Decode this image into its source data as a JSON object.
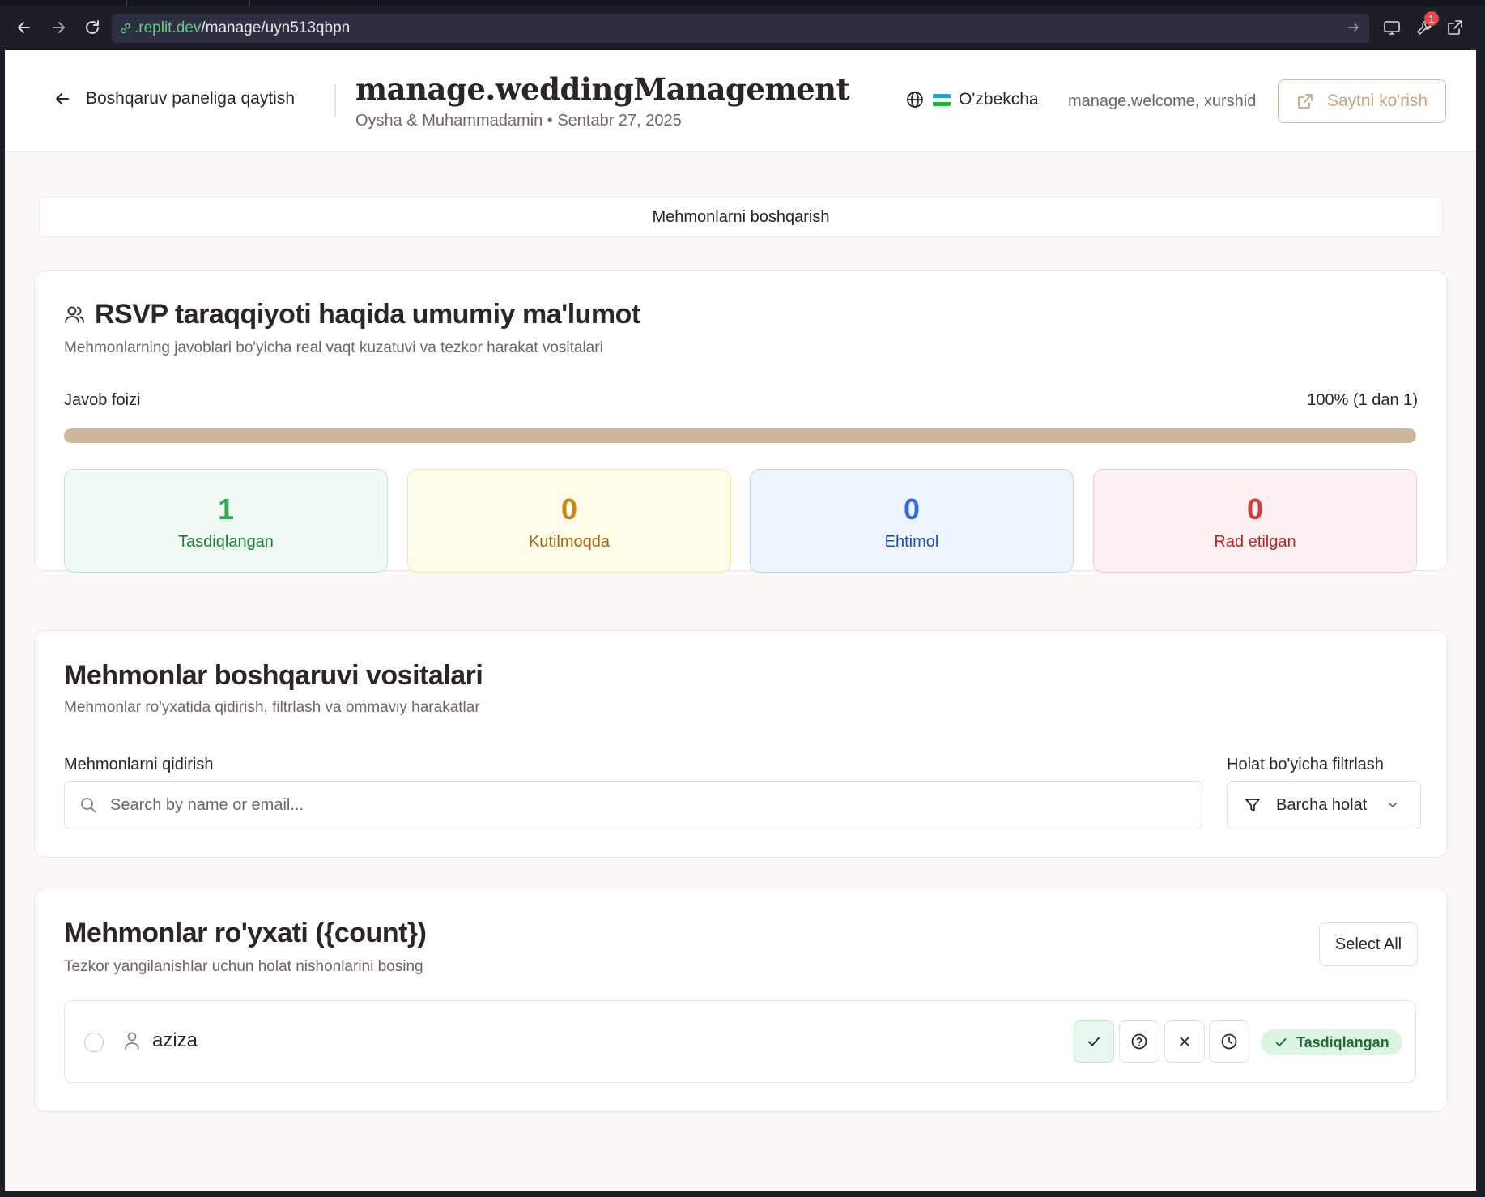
{
  "browser": {
    "url_host": ".replit.dev",
    "url_path": "/manage/uyn513qbpn",
    "extension_badge": "1"
  },
  "header": {
    "back_label": "Boshqaruv paneliga qaytish",
    "title": "manage.weddingManagement",
    "subtitle": "Oysha & Muhammadamin • Sentabr 27, 2025",
    "language": "O'zbekcha",
    "welcome": "manage.welcome, xurshid",
    "view_site_label": "Saytni ko'rish"
  },
  "tabs": {
    "active": "Mehmonlarni boshqarish"
  },
  "rsvp": {
    "title": "RSVP taraqqiyoti haqida umumiy ma'lumot",
    "description": "Mehmonlarning javoblari bo'yicha real vaqt kuzatuvi va tezkor harakat vositalari",
    "progress_label": "Javob foizi",
    "progress_text": "100% (1 dan 1)",
    "progress_fraction": 1.0,
    "stats": {
      "confirmed": {
        "value": "1",
        "label": "Tasdiqlangan"
      },
      "pending": {
        "value": "0",
        "label": "Kutilmoqda"
      },
      "maybe": {
        "value": "0",
        "label": "Ehtimol"
      },
      "declined": {
        "value": "0",
        "label": "Rad etilgan"
      }
    }
  },
  "tools": {
    "title": "Mehmonlar boshqaruvi vositalari",
    "description": "Mehmonlar ro'yxatida qidirish, filtrlash va ommaviy harakatlar",
    "search_label": "Mehmonlarni qidirish",
    "search_placeholder": "Search by name or email...",
    "search_value": "",
    "filter_label": "Holat bo'yicha filtrlash",
    "filter_value": "Barcha holat"
  },
  "guest_list": {
    "title": "Mehmonlar ro'yxati ({count})",
    "description": "Tezkor yangilanishlar uchun holat nishonlarini bosing",
    "select_all_label": "Select All",
    "guests": [
      {
        "name": "aziza",
        "status": "Tasdiqlangan"
      }
    ]
  },
  "colors": {
    "accent": "#cdb79c",
    "confirmed": "#34a853",
    "pending": "#c4861f",
    "maybe": "#2f6be4",
    "declined": "#d63c3c"
  }
}
